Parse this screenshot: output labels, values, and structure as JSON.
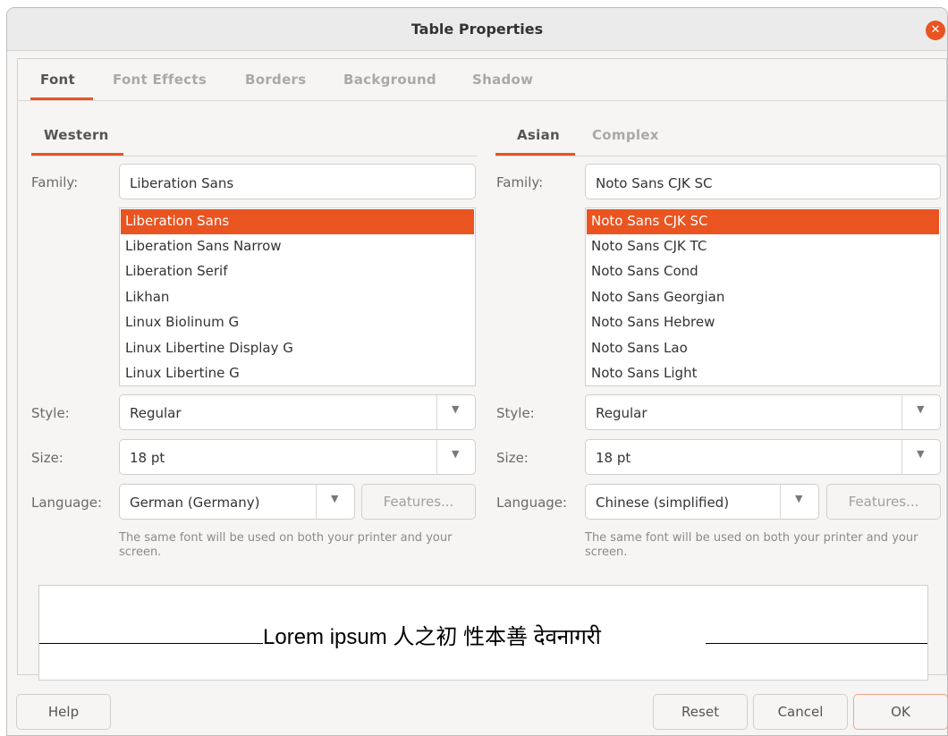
{
  "window": {
    "title": "Table Properties"
  },
  "tabs": [
    "Font",
    "Font Effects",
    "Borders",
    "Background",
    "Shadow"
  ],
  "western": {
    "tab": "Western",
    "family_label": "Family:",
    "family_value": "Liberation Sans",
    "fonts": [
      "Liberation Sans",
      "Liberation Sans Narrow",
      "Liberation Serif",
      "Likhan",
      "Linux Biolinum G",
      "Linux Libertine Display G",
      "Linux Libertine G"
    ],
    "selected_index": 0,
    "style_label": "Style:",
    "style_value": "Regular",
    "size_label": "Size:",
    "size_value": "18 pt",
    "language_label": "Language:",
    "language_value": "German (Germany)",
    "features_label": "Features...",
    "hint": "The same font will be used on both your printer and your screen."
  },
  "asian": {
    "tabs": [
      "Asian",
      "Complex"
    ],
    "family_label": "Family:",
    "family_value": "Noto Sans CJK SC",
    "fonts": [
      "Noto Sans CJK SC",
      "Noto Sans CJK TC",
      "Noto Sans Cond",
      "Noto Sans Georgian",
      "Noto Sans Hebrew",
      "Noto Sans Lao",
      "Noto Sans Light"
    ],
    "selected_index": 0,
    "style_label": "Style:",
    "style_value": "Regular",
    "size_label": "Size:",
    "size_value": "18 pt",
    "language_label": "Language:",
    "language_value": "Chinese (simplified)",
    "features_label": "Features...",
    "hint": "The same font will be used on both your printer and your screen."
  },
  "preview": {
    "text": "Lorem ipsum   人之初 性本善  देवनागरी"
  },
  "buttons": {
    "help": "Help",
    "reset": "Reset",
    "cancel": "Cancel",
    "ok": "OK"
  },
  "colors": {
    "accent": "#e95420"
  }
}
